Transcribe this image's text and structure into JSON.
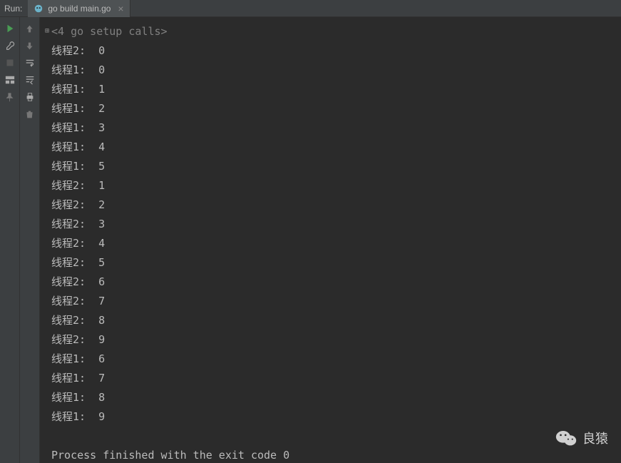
{
  "header": {
    "run_label": "Run:",
    "tab_label": "go build main.go"
  },
  "console": {
    "setup_calls": "<4 go setup calls>",
    "lines": [
      "线程2:  0",
      "线程1:  0",
      "线程1:  1",
      "线程1:  2",
      "线程1:  3",
      "线程1:  4",
      "线程1:  5",
      "线程2:  1",
      "线程2:  2",
      "线程2:  3",
      "线程2:  4",
      "线程2:  5",
      "线程2:  6",
      "线程2:  7",
      "线程2:  8",
      "线程2:  9",
      "线程1:  6",
      "线程1:  7",
      "线程1:  8",
      "线程1:  9"
    ],
    "process_finished": "Process finished with the exit code 0"
  },
  "watermark": {
    "text": "良猿"
  }
}
